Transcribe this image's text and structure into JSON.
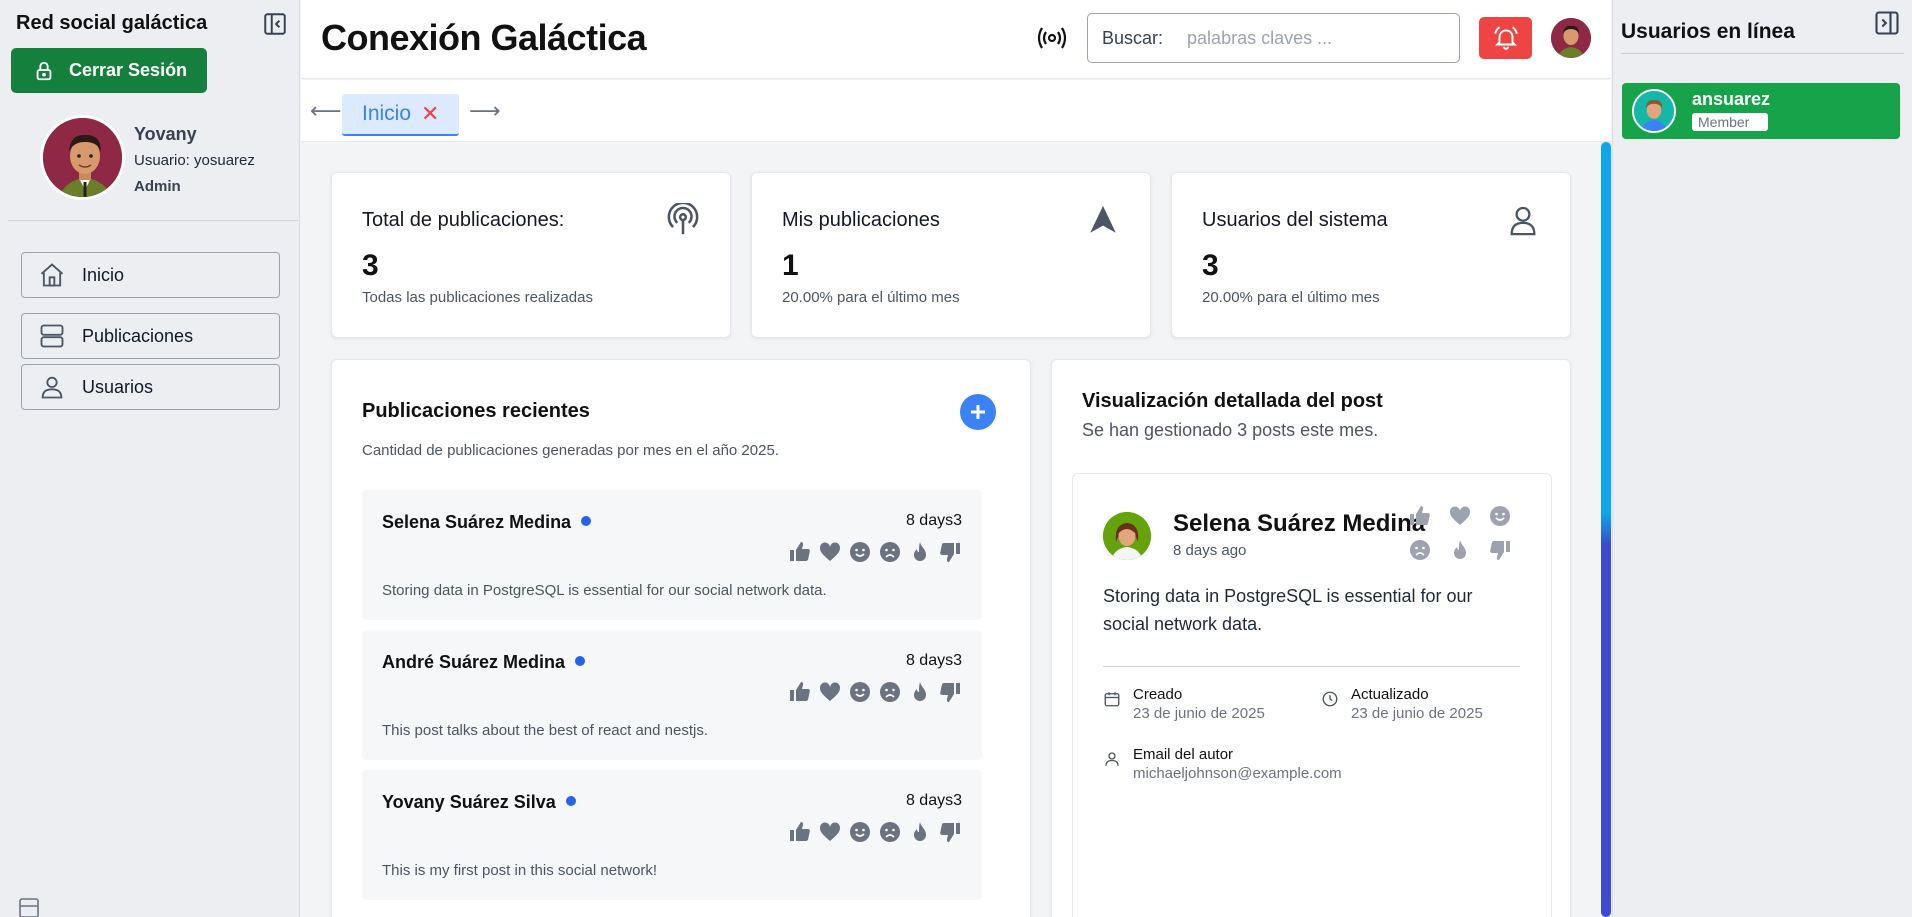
{
  "sidebar": {
    "brand": "Red social galáctica",
    "logout_label": "Cerrar Sesión",
    "profile": {
      "name": "Yovany",
      "username": "Usuario: yosuarez",
      "role": "Admin"
    },
    "nav": [
      {
        "label": "Inicio",
        "icon": "home-icon"
      },
      {
        "label": "Publicaciones",
        "icon": "server-icon"
      },
      {
        "label": "Usuarios",
        "icon": "user-icon"
      }
    ]
  },
  "header": {
    "title": "Conexión Galáctica",
    "search": {
      "label": "Buscar:",
      "placeholder": "palabras claves ...",
      "value": ""
    }
  },
  "tabs": [
    {
      "label": "Inicio",
      "active": true
    }
  ],
  "stats": [
    {
      "title": "Total de publicaciones:",
      "value": "3",
      "sub": "Todas las publicaciones realizadas",
      "icon": "podcast-icon"
    },
    {
      "title": "Mis publicaciones",
      "value": "1",
      "sub": "20.00% para el último mes",
      "icon": "navigation-arrow-icon"
    },
    {
      "title": "Usuarios del sistema",
      "value": "3",
      "sub": "20.00% para el último mes",
      "icon": "user-icon"
    }
  ],
  "recent": {
    "title": "Publicaciones recientes",
    "subtitle": "Cantidad de publicaciones generadas por mes en el año 2025.",
    "posts": [
      {
        "author": "Selena Suárez Medina",
        "time": "8 days3",
        "text": "Storing data in PostgreSQL is essential for our social network data."
      },
      {
        "author": "André Suárez Medina",
        "time": "8 days3",
        "text": "This post talks about the best of react and nestjs."
      },
      {
        "author": "Yovany Suárez Silva",
        "time": "8 days3",
        "text": "This is my first post in this social network!"
      }
    ]
  },
  "detail": {
    "title": "Visualización detallada del post",
    "subtitle": "Se han gestionado 3 posts este mes.",
    "author": "Selena Suárez Medina",
    "time": "8 days ago",
    "text": "Storing data in PostgreSQL is essential for our social network data.",
    "created_label": "Creado",
    "created_value": "23 de junio de 2025",
    "updated_label": "Actualizado",
    "updated_value": "23 de junio de 2025",
    "email_label": "Email del autor",
    "email_value": "michaeljohnson@example.com"
  },
  "online": {
    "title": "Usuarios en línea",
    "users": [
      {
        "name": "ansuarez",
        "role": "Member"
      }
    ]
  },
  "colors": {
    "logout_bg": "#15803d",
    "bell_bg": "#ef4444",
    "accent": "#3b82f6",
    "online_bg": "#16a34a"
  }
}
